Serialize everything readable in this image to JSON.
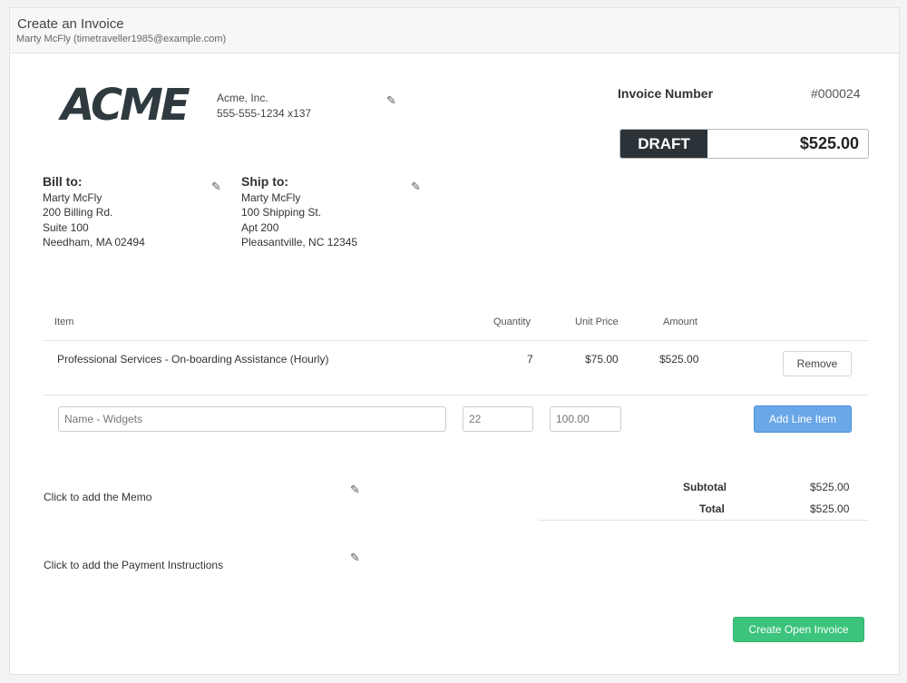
{
  "header": {
    "title": "Create an Invoice",
    "subtitle": "Marty McFly (timetraveller1985@example.com)"
  },
  "company": {
    "logo_text": "ACME",
    "name": "Acme, Inc.",
    "phone": "555-555-1234 x137"
  },
  "invoice": {
    "number_label": "Invoice Number",
    "number": "#000024",
    "status": "DRAFT",
    "amount": "$525.00"
  },
  "bill_to": {
    "title": "Bill to:",
    "name": "Marty McFly",
    "line1": "200 Billing Rd.",
    "line2": "Suite 100",
    "city": "Needham, MA 02494"
  },
  "ship_to": {
    "title": "Ship to:",
    "name": "Marty McFly",
    "line1": "100 Shipping St.",
    "line2": "Apt 200",
    "city": "Pleasantville, NC 12345"
  },
  "table": {
    "headers": {
      "item": "Item",
      "quantity": "Quantity",
      "unit_price": "Unit Price",
      "amount": "Amount"
    },
    "rows": [
      {
        "item": "Professional Services - On-boarding Assistance (Hourly)",
        "quantity": "7",
        "unit_price": "$75.00",
        "amount": "$525.00",
        "remove_label": "Remove"
      }
    ]
  },
  "new_item": {
    "name_placeholder": "Name - Widgets",
    "quantity_placeholder": "22",
    "price_placeholder": "100.00",
    "add_label": "Add Line Item"
  },
  "memo": {
    "label": "Click to add the Memo"
  },
  "payment_instructions": {
    "label": "Click to add the Payment Instructions"
  },
  "totals": {
    "subtotal_label": "Subtotal",
    "subtotal": "$525.00",
    "total_label": "Total",
    "total": "$525.00"
  },
  "actions": {
    "create_label": "Create Open Invoice"
  },
  "colors": {
    "status_badge_bg": "#2c3338",
    "add_button": "#6aa7e8",
    "create_button": "#3cc47c"
  },
  "icons": {
    "edit": "pencil-icon"
  }
}
